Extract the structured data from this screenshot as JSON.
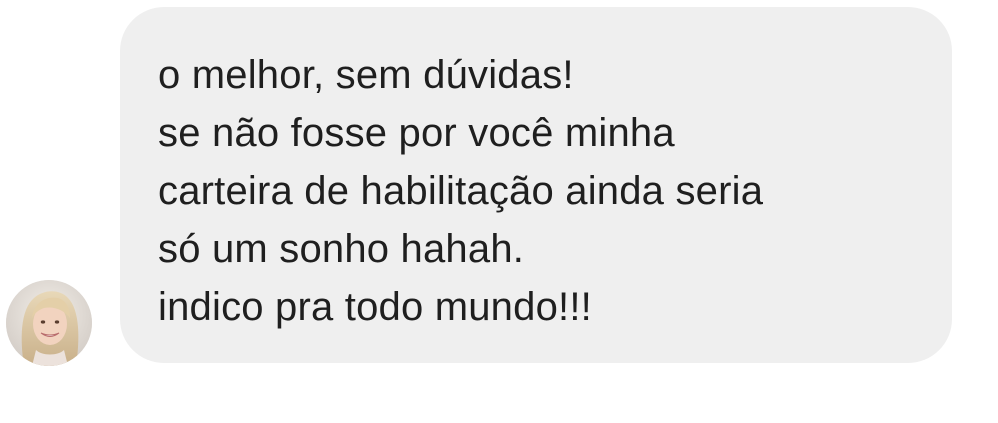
{
  "message": {
    "lines": [
      "o melhor, sem dúvidas!",
      "se não fosse por você minha",
      "carteira de habilitação ainda seria",
      "só um sonho hahah.",
      "indico pra todo mundo!!!"
    ],
    "bubble_color": "#efefef",
    "text_color": "#1f1f1f"
  },
  "sender": {
    "avatar_icon": "profile-photo"
  }
}
